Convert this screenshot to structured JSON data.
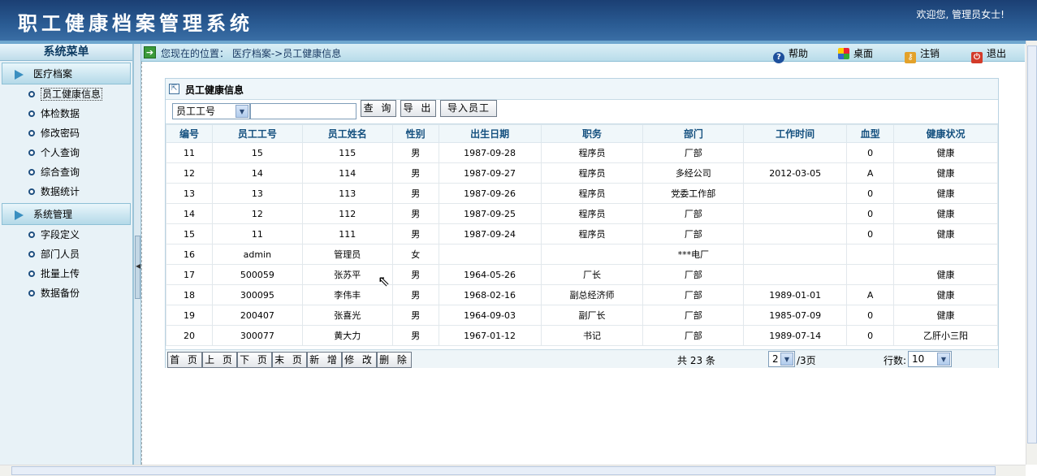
{
  "header": {
    "title": "职工健康档案管理系统",
    "welcome": "欢迎您, 管理员女士!"
  },
  "sidebar": {
    "title": "系统菜单",
    "groups": [
      {
        "label": "医疗档案",
        "items": [
          "员工健康信息",
          "体检数据",
          "修改密码",
          "个人查询",
          "综合查询",
          "数据统计"
        ]
      },
      {
        "label": "系统管理",
        "items": [
          "字段定义",
          "部门人员",
          "批量上传",
          "数据备份"
        ]
      }
    ]
  },
  "crumb": {
    "text": "您现在的位置： 医疗档案->员工健康信息"
  },
  "toolbar": {
    "help": "帮助",
    "desktop": "桌面",
    "logout": "注销",
    "exit": "退出"
  },
  "panel": {
    "title": "员工健康信息"
  },
  "search": {
    "field": "员工工号",
    "query": "查 询",
    "export": "导 出",
    "import": "导入员工"
  },
  "table": {
    "headers": [
      "编号",
      "员工工号",
      "员工姓名",
      "性别",
      "出生日期",
      "职务",
      "部门",
      "工作时间",
      "血型",
      "健康状况"
    ],
    "rows": [
      [
        "11",
        "15",
        "115",
        "男",
        "1987-09-28",
        "程序员",
        "厂部",
        "",
        "0",
        "健康"
      ],
      [
        "12",
        "14",
        "114",
        "男",
        "1987-09-27",
        "程序员",
        "多经公司",
        "2012-03-05",
        "A",
        "健康"
      ],
      [
        "13",
        "13",
        "113",
        "男",
        "1987-09-26",
        "程序员",
        "党委工作部",
        "",
        "0",
        "健康"
      ],
      [
        "14",
        "12",
        "112",
        "男",
        "1987-09-25",
        "程序员",
        "厂部",
        "",
        "0",
        "健康"
      ],
      [
        "15",
        "11",
        "111",
        "男",
        "1987-09-24",
        "程序员",
        "厂部",
        "",
        "0",
        "健康"
      ],
      [
        "16",
        "admin",
        "管理员",
        "女",
        "",
        "",
        "***电厂",
        "",
        "",
        ""
      ],
      [
        "17",
        "500059",
        "张苏平",
        "男",
        "1964-05-26",
        "厂长",
        "厂部",
        "",
        "",
        "健康"
      ],
      [
        "18",
        "300095",
        "李伟丰",
        "男",
        "1968-02-16",
        "副总经济师",
        "厂部",
        "1989-01-01",
        "A",
        "健康"
      ],
      [
        "19",
        "200407",
        "张喜光",
        "男",
        "1964-09-03",
        "副厂长",
        "厂部",
        "1985-07-09",
        "0",
        "健康"
      ],
      [
        "20",
        "300077",
        "黄大力",
        "男",
        "1967-01-12",
        "书记",
        "厂部",
        "1989-07-14",
        "0",
        "乙肝小三阳"
      ]
    ]
  },
  "pager": {
    "buttons": [
      "首 页",
      "上 页",
      "下 页",
      "末 页",
      "新 增",
      "修 改",
      "删 除"
    ],
    "total": "共 23 条",
    "page": "2",
    "page_suffix": "/3页",
    "rows_label": "行数:",
    "rows_value": "10"
  }
}
